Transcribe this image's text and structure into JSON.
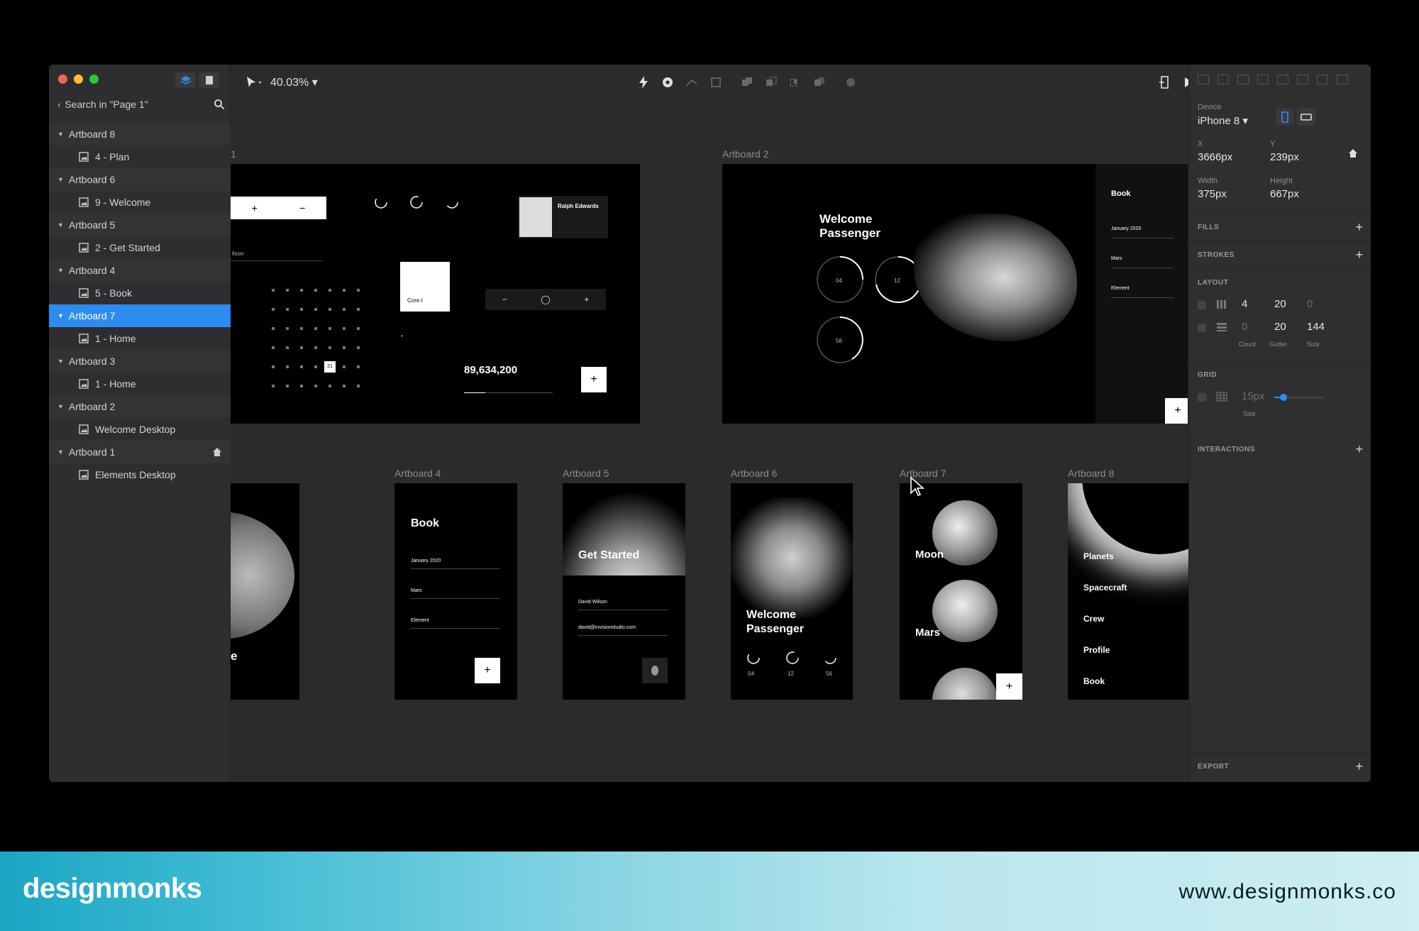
{
  "toolbar": {
    "zoom": "40.03% ▾"
  },
  "sidebar": {
    "search_label": "Search in \"Page 1\"",
    "layers": [
      {
        "name": "Artboard 8",
        "child": "4 - Plan",
        "selected": false,
        "home": false
      },
      {
        "name": "Artboard 6",
        "child": "9 - Welcome",
        "selected": false,
        "home": false
      },
      {
        "name": "Artboard 5",
        "child": "2 - Get Started",
        "selected": false,
        "home": false
      },
      {
        "name": "Artboard 4",
        "child": "5 - Book",
        "selected": false,
        "home": false
      },
      {
        "name": "Artboard 7",
        "child": "1 - Home",
        "selected": true,
        "home": false
      },
      {
        "name": "Artboard 3",
        "child": "1 - Home",
        "selected": false,
        "home": false
      },
      {
        "name": "Artboard 2",
        "child": "Welcome Desktop",
        "selected": false,
        "home": false
      },
      {
        "name": "Artboard 1",
        "child": "Elements Desktop",
        "selected": false,
        "home": true
      }
    ]
  },
  "canvas": {
    "labels": {
      "ab1": "1",
      "ab2": "Artboard 2",
      "ab4": "Artboard 4",
      "ab5": "Artboard 5",
      "ab6": "Artboard 6",
      "ab7": "Artboard 7",
      "ab8": "Artboard 8"
    },
    "ab1": {
      "stat": "89,634,200",
      "profile_name": "Ralph Edwards",
      "card_label": "Core I",
      "cal_selected": "21",
      "partial": "ilson",
      "dot": "•"
    },
    "ab2": {
      "welcome": "Welcome Passenger",
      "book": "Book",
      "date": "January 2020",
      "dest": "Mars",
      "element": "Element",
      "rings": [
        "04",
        "12",
        "56"
      ]
    },
    "ab3": {
      "partial": "e"
    },
    "ab4": {
      "title": "Book",
      "date": "January 2020",
      "dest": "Mars",
      "element": "Element"
    },
    "ab5": {
      "title": "Get Started",
      "name": "David Wilson",
      "email": "david@invisionstudio.com"
    },
    "ab6": {
      "title": "Welcome Passenger",
      "rings": [
        "04",
        "12",
        "56"
      ]
    },
    "ab7": {
      "moon": "Moon",
      "mars": "Mars"
    },
    "ab8": {
      "items": [
        "Planets",
        "Spacecraft",
        "Crew",
        "Profile",
        "Book"
      ]
    }
  },
  "inspector": {
    "device_label": "Device",
    "device_value": "iPhone 8 ▾",
    "x_label": "X",
    "x_value": "3666px",
    "y_label": "Y",
    "y_value": "239px",
    "w_label": "Width",
    "w_value": "375px",
    "h_label": "Height",
    "h_value": "667px",
    "fills": "FILLS",
    "strokes": "STROKES",
    "layout": "LAYOUT",
    "layout_row1": {
      "count": "4",
      "gutter": "20",
      "size": "0"
    },
    "layout_row2": {
      "count": "0",
      "gutter": "20",
      "size": "144"
    },
    "count_label": "Count",
    "gutter_label": "Gutter",
    "size_label": "Size",
    "grid": "GRID",
    "grid_value": "15px",
    "grid_size_label": "Size",
    "interactions": "INTERACTIONS",
    "export": "EXPORT"
  },
  "brand": {
    "logo": "designmonks",
    "url": "www.designmonks.co"
  },
  "colors": {
    "accent": "#2d8cf0",
    "window_bg": "#2b2b2d",
    "brand_gradient_start": "#1aa6c4"
  }
}
